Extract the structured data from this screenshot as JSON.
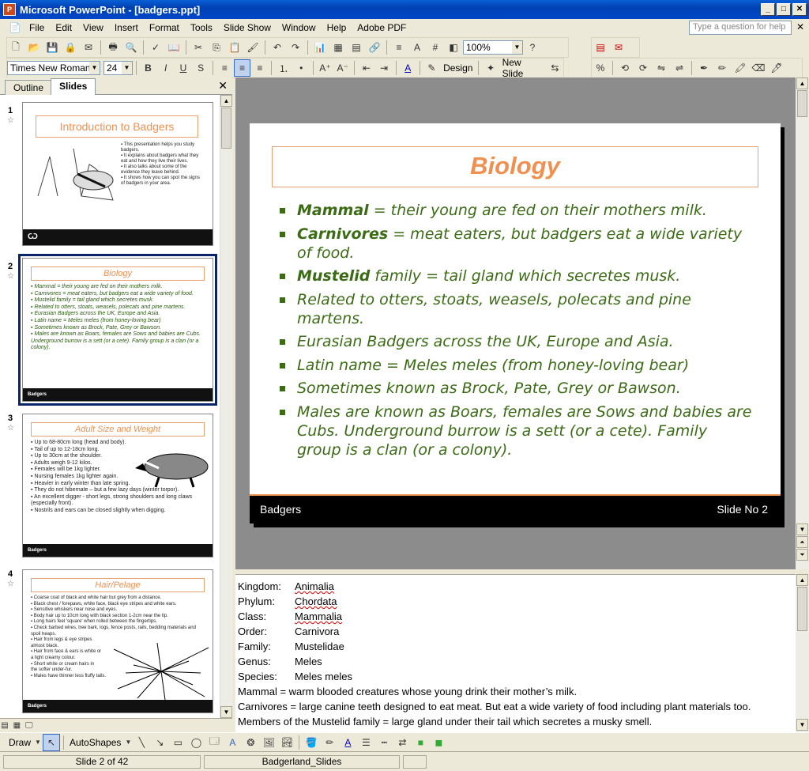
{
  "window": {
    "title": "Microsoft PowerPoint - [badgers.ppt]",
    "app_icon": "P"
  },
  "menu": [
    "File",
    "Edit",
    "View",
    "Insert",
    "Format",
    "Tools",
    "Slide Show",
    "Window",
    "Help",
    "Adobe PDF"
  ],
  "help_placeholder": "Type a question for help",
  "toolbar": {
    "zoom": "100%",
    "font": "Times New Roman",
    "size": "24",
    "design_label": "Design",
    "newslide_label": "New Slide"
  },
  "pane_tabs": [
    "Outline",
    "Slides"
  ],
  "thumbnails": [
    {
      "num": "1",
      "title": "Introduction to Badgers",
      "bullets": [
        "This presentation helps you study badgers.",
        "It explains about badgers what they eat and how they live their lives.",
        "It also talks about some of the evidence they leave behind.",
        "It shows how you can spot the signs of badgers in your area."
      ],
      "footer": "Badgers"
    },
    {
      "num": "2",
      "title": "Biology",
      "bullets": [
        "Mammal = their young are fed on their mothers milk.",
        "Carnivores = meat eaters, but badgers eat a wide variety of food.",
        "Mustelid family = tail gland which secretes musk.",
        "Related to otters, stoats, weasels, polecats and pine martens.",
        "Eurasian Badgers across the UK, Europe and Asia.",
        "Latin name = Meles meles (from honey-loving bear)",
        "Sometimes known as Brock, Pate, Grey or Bawson.",
        "Males are known as Boars, females are Sows and babies are Cubs. Underground burrow is a sett (or a cete). Family group is a clan (or a colony)."
      ],
      "footer": "Badgers"
    },
    {
      "num": "3",
      "title": "Adult Size and Weight",
      "bullets": [
        "Up to 68-80cm long (head and body).",
        "Tail of up to 12-18cm long.",
        "Up to 30cm at the shoulder.",
        "Adults weigh 9-12 kilos.",
        "Females will be 1kg lighter.",
        "Nursing females 1kg lighter again.",
        "Heavier in early winter than late spring.",
        "They do not hibernate – but a few lazy days (winter torpor).",
        "An excellent digger - short legs, strong shoulders and long claws (especially front).",
        "Nostrils and ears can be closed slightly when digging."
      ],
      "footer": "Badgers"
    },
    {
      "num": "4",
      "title": "Hair/Pelage",
      "bullets": [
        "Coarse coat of black and white hair but grey from a distance.",
        "Black chest / forepaws, white face, black eye stripes and white ears.",
        "Sensitive whiskers near nose and eyes.",
        "Body hair up to 10cm long with black section 1-2cm near the tip.",
        "Long hairs feel 'square' when rolled between the fingertips.",
        "Check barbed wires, tree bark, logs, fence posts, rails, bedding materials and spoil heaps.",
        "Hair from legs & eye stripes almost black.",
        "Hair from face & ears is white or a light creamy colour.",
        "Short white or cream hairs in the softer under-fur.",
        "Males have thinner less fluffy tails."
      ],
      "footer": "Badgers"
    }
  ],
  "slide": {
    "title": "Biology",
    "bullets": [
      {
        "strong": "Mammal",
        "rest": " = their young are fed on their mothers milk."
      },
      {
        "strong": "Carnivores",
        "rest": " = meat eaters, but badgers eat a wide variety of food."
      },
      {
        "strong": "Mustelid",
        "rest": " family = tail gland which secretes musk."
      },
      {
        "strong": "",
        "rest": "Related to otters, stoats, weasels, polecats and pine martens."
      },
      {
        "strong": "",
        "rest": "Eurasian Badgers across the UK, Europe and Asia."
      },
      {
        "strong": "",
        "rest": "Latin name = Meles meles (from honey-loving bear)"
      },
      {
        "strong": "",
        "rest": "Sometimes known as Brock, Pate, Grey or Bawson."
      },
      {
        "strong": "",
        "rest": "Males are known as Boars, females are Sows and babies are Cubs. Underground burrow is a sett (or a cete). Family group is a clan (or a colony)."
      }
    ],
    "footer_left": "Badgers",
    "footer_right": "Slide No 2"
  },
  "notes": {
    "taxonomy": [
      {
        "k": "Kingdom:",
        "v": "Animalia"
      },
      {
        "k": "Phylum:",
        "v": "Chordata"
      },
      {
        "k": "Class:",
        "v": "Mammalia"
      },
      {
        "k": "Order:",
        "v": "Carnivora"
      },
      {
        "k": "Family:",
        "v": "Mustelidae"
      },
      {
        "k": "Genus:",
        "v": "Meles"
      },
      {
        "k": "Species:",
        "v": "Meles meles"
      }
    ],
    "lines": [
      "Mammal = warm blooded creatures whose young drink their mother’s milk.",
      "Carnivores = large canine teeth designed to eat meat. But eat a wide variety of food including plant materials too.",
      "Members of the Mustelid family = large gland under their tail which secretes a musky smell."
    ]
  },
  "drawbar": {
    "draw": "Draw",
    "autoshapes": "AutoShapes"
  },
  "status": {
    "slide": "Slide 2 of 42",
    "design": "Badgerland_Slides"
  }
}
